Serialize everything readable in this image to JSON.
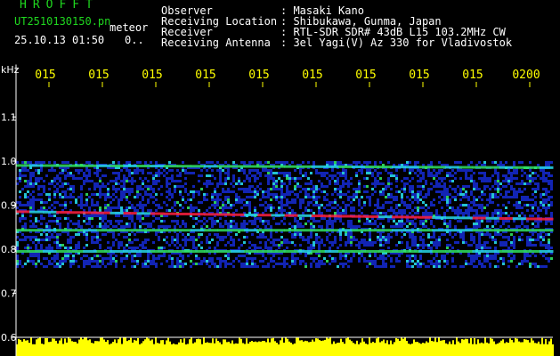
{
  "header": {
    "brand": "HROFFT",
    "filename": "UT2510130150.pn",
    "meteor_label": "meteor",
    "datetime": "25.10.13 01:50",
    "count": "0..",
    "info": [
      {
        "label": "Observer",
        "value": ": Masaki Kano"
      },
      {
        "label": "Receiving Location",
        "value": ": Shibukawa, Gunma, Japan"
      },
      {
        "label": "Receiver",
        "value": ": RTL-SDR SDR# 43dB L15 103.2MHz CW"
      },
      {
        "label": "Receiving Antenna",
        "value": ": 3el Yagi(V) Az 330 for Vladivostok"
      }
    ]
  },
  "colors": {
    "background": "#000000",
    "text_green": "#1fd81f",
    "text_white": "#ffffff",
    "tick_yellow": "#ffff00",
    "signal_blue": "#1428c8",
    "signal_cyan": "#28d8e8",
    "signal_green": "#30e060",
    "signal_red": "#ff2040",
    "level_yellow": "#ffff00"
  },
  "chart_data": {
    "type": "heatmap",
    "ylabel": "kHz",
    "y_ticks": [
      "1.1",
      "1.0",
      "0.9",
      "0.8",
      "0.7",
      "0.6"
    ],
    "ylim": [
      0.6,
      1.15
    ],
    "x_ticks": [
      "015",
      "015",
      "015",
      "015",
      "015",
      "015",
      "015",
      "015",
      "015",
      "0200"
    ],
    "signal_band": [
      0.76,
      1.0
    ],
    "strong_lines": [
      {
        "start": 0.885,
        "end": 0.868,
        "intensity": "high"
      },
      {
        "start": 0.99,
        "end": 0.985,
        "intensity": "medium"
      },
      {
        "start": 0.843,
        "end": 0.843,
        "intensity": "medium"
      },
      {
        "start": 0.795,
        "end": 0.795,
        "intensity": "medium"
      }
    ],
    "level_strip_color": "yellow"
  }
}
